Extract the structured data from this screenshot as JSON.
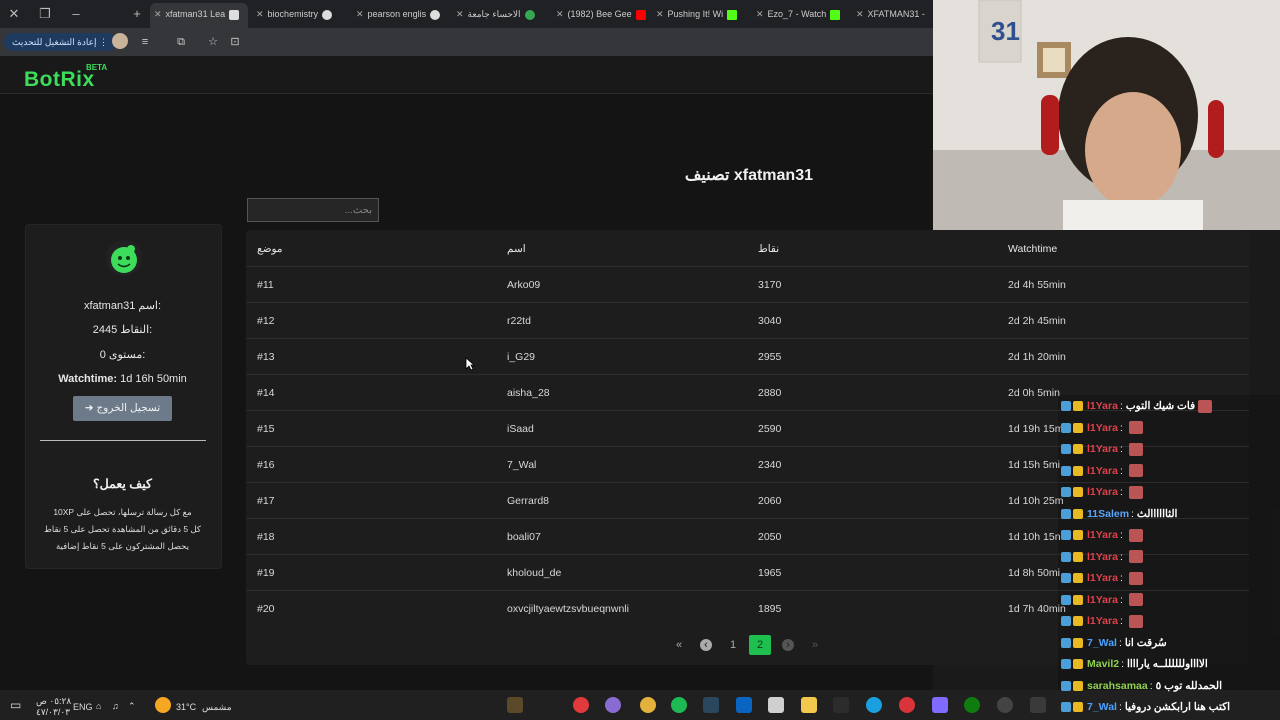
{
  "browser": {
    "tabs": [
      {
        "label": "xfatman31 Lea",
        "active": true
      },
      {
        "label": "biochemistry",
        "active": false
      },
      {
        "label": "pearson englis",
        "active": false
      },
      {
        "label": "الاحساء جامعة",
        "active": false
      },
      {
        "label": "(1982) Bee Gee",
        "active": false
      },
      {
        "label": "Pushing It! Wi",
        "active": false
      },
      {
        "label": "Ezo_7 - Watch",
        "active": false
      },
      {
        "label": "XFATMAN31 -",
        "active": false
      }
    ],
    "update_button": "إعادة التشغيل للتحديث"
  },
  "site": {
    "logo": "BotRix",
    "beta": "BETA",
    "title": "xfatman31 تصنيف",
    "search_placeholder": "بحث..."
  },
  "profile": {
    "name_line": "xfatman31 اسم:",
    "points_line": "2445 النقاط:",
    "level_line": "0 مستوى:",
    "watchtime_label": "Watchtime:",
    "watchtime_value": "1d 16h 50min",
    "logout": "تسجيل الخروج",
    "how_title": "كيف يعمل؟",
    "how_lines": [
      "مع كل رسالة ترسلها، تحصل على 10XP",
      "كل 5 دقائق من المشاهدة تحصل على 5 نقاط",
      "يحصل المشتركون على 5 نقاط إضافية"
    ]
  },
  "table": {
    "headers": [
      "موضع",
      "اسم",
      "نقاط",
      "Watchtime"
    ],
    "rows": [
      [
        "#11",
        "Arko09",
        "3170",
        "2d 4h 55min"
      ],
      [
        "#12",
        "r22td",
        "3040",
        "2d 2h 45min"
      ],
      [
        "#13",
        "i_G29",
        "2955",
        "2d 1h 20min"
      ],
      [
        "#14",
        "aisha_28",
        "2880",
        "2d 0h 5min"
      ],
      [
        "#15",
        "iSaad",
        "2590",
        "1d 19h 15m"
      ],
      [
        "#16",
        "7_Wal",
        "2340",
        "1d 15h 5mi"
      ],
      [
        "#17",
        "Gerrard8",
        "2060",
        "1d 10h 25m"
      ],
      [
        "#18",
        "boali07",
        "2050",
        "1d 10h 15n"
      ],
      [
        "#19",
        "kholoud_de",
        "1965",
        "1d 8h 50mi"
      ],
      [
        "#20",
        "oxvcjiltyaewtzsvbueqnwnli",
        "1895",
        "1d 7h 40min"
      ]
    ]
  },
  "pagination": {
    "first": "«",
    "prev": "‹",
    "pages": [
      "1",
      "2"
    ],
    "current": "2",
    "next": "›",
    "last": "»"
  },
  "chat": [
    {
      "user": "l1Yara",
      "msg": "فات شيك التوب",
      "user_color": "#e0404a",
      "emote": true
    },
    {
      "user": "l1Yara",
      "msg": "",
      "user_color": "#e0404a",
      "emote": true
    },
    {
      "user": "l1Yara",
      "msg": "",
      "user_color": "#e0404a",
      "emote": true
    },
    {
      "user": "l1Yara",
      "msg": "",
      "user_color": "#e0404a",
      "emote": true
    },
    {
      "user": "l1Yara",
      "msg": "",
      "user_color": "#e0404a",
      "emote": true
    },
    {
      "user": "11Salem",
      "msg": "الثاااااالث",
      "user_color": "#5aa6ff",
      "emote": false
    },
    {
      "user": "l1Yara",
      "msg": "",
      "user_color": "#e0404a",
      "emote": true
    },
    {
      "user": "l1Yara",
      "msg": "",
      "user_color": "#e0404a",
      "emote": true
    },
    {
      "user": "l1Yara",
      "msg": "",
      "user_color": "#e0404a",
      "emote": true
    },
    {
      "user": "l1Yara",
      "msg": "",
      "user_color": "#e0404a",
      "emote": true
    },
    {
      "user": "l1Yara",
      "msg": "",
      "user_color": "#e0404a",
      "emote": true
    },
    {
      "user": "7_Wal",
      "msg": "سُرقت انا",
      "user_color": "#4aa3ff",
      "emote": false
    },
    {
      "user": "Mavil2",
      "msg": "الااااوللللللــه ياراااا",
      "user_color": "#8fd14f",
      "emote": false
    },
    {
      "user": "sarahsamaa",
      "msg": "الحمدلله توب ٥",
      "user_color": "#8fd14f",
      "emote": false
    },
    {
      "user": "7_Wal",
      "msg": "اكتب هنا ارابكشن دروفيا",
      "user_color": "#4aa3ff",
      "emote": false
    }
  ],
  "taskbar": {
    "weather": "31°C",
    "weather_label": "مشمس",
    "lang": "ENG",
    "time": "٠٥:٢٨ ص",
    "date": "٤٧/٠٣/٠٣"
  },
  "colors": {
    "accent": "#3ddc5a",
    "page_active": "#1fbf4f"
  }
}
